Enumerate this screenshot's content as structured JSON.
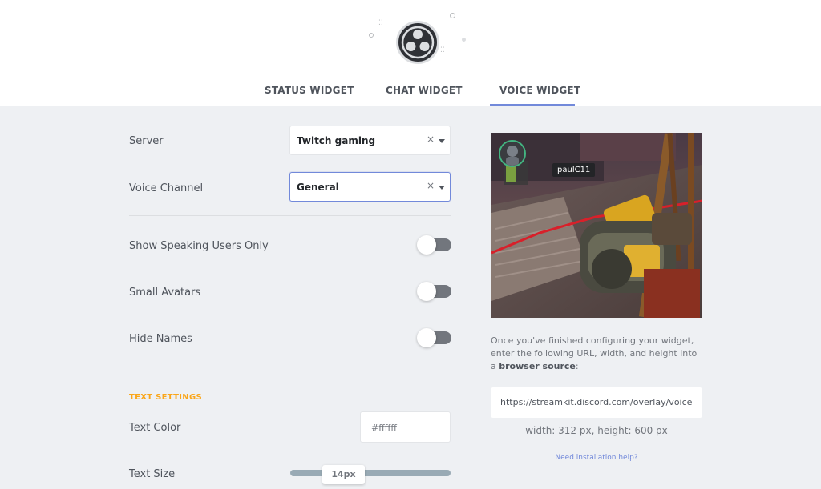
{
  "header": {
    "logo_icon": "obs-logo-icon",
    "tabs": [
      {
        "label": "STATUS WIDGET",
        "active": false
      },
      {
        "label": "CHAT WIDGET",
        "active": false
      },
      {
        "label": "VOICE WIDGET",
        "active": true
      }
    ],
    "accent_color": "#7289da"
  },
  "form": {
    "server": {
      "label": "Server",
      "value": "Twitch gaming",
      "clear": "×"
    },
    "voice_channel": {
      "label": "Voice Channel",
      "value": "General",
      "clear": "×"
    },
    "toggles": [
      {
        "label": "Show Speaking Users Only",
        "on": false
      },
      {
        "label": "Small Avatars",
        "on": false
      },
      {
        "label": "Hide Names",
        "on": false
      }
    ],
    "text_settings": {
      "title": "TEXT SETTINGS",
      "title_color": "#faa61a",
      "text_color": {
        "label": "Text Color",
        "value": "#ffffff"
      },
      "text_size": {
        "label": "Text Size",
        "value": "14px"
      }
    }
  },
  "preview": {
    "username": "paulC11",
    "instructions_prefix": "Once you've finished configuring your widget, enter the following URL, width, and height into a ",
    "instructions_bold": "browser source",
    "instructions_suffix": ":",
    "url": "https://streamkit.discord.com/overlay/voice",
    "dimensions": "width: 312 px, height: 600 px",
    "help_link": "Need installation help?"
  }
}
